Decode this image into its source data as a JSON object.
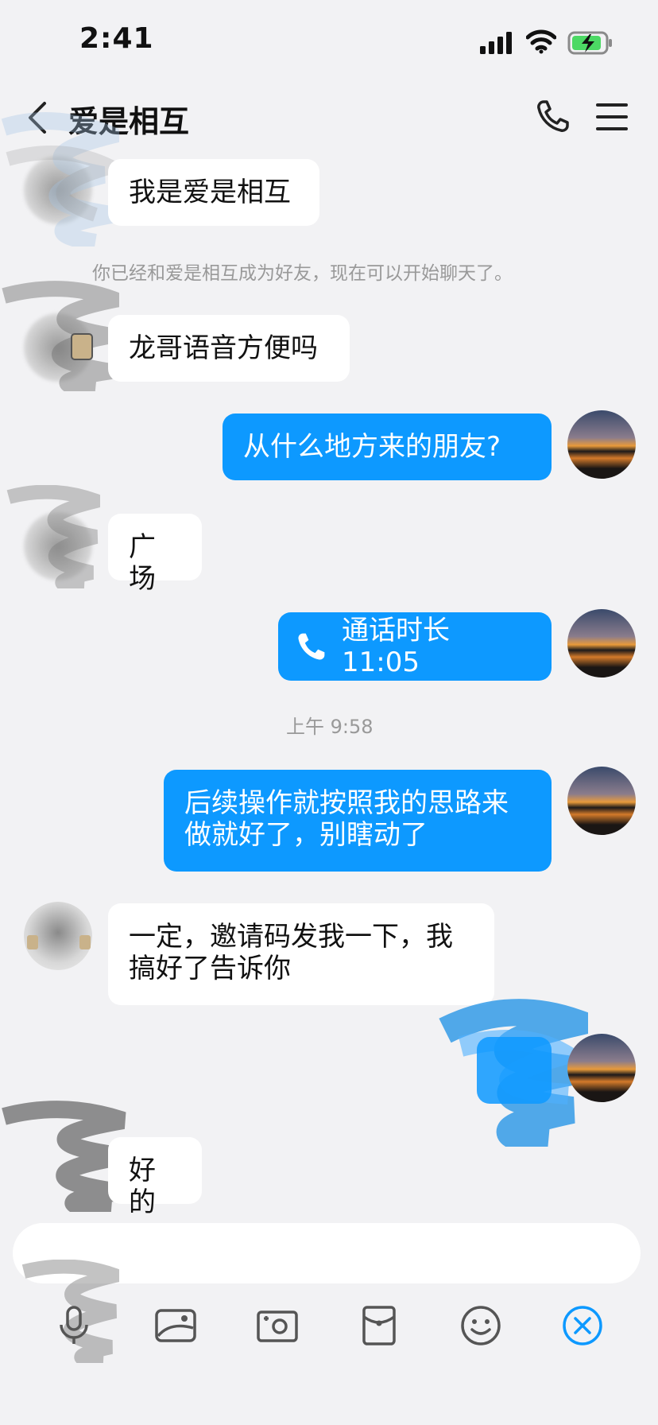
{
  "status_bar": {
    "time": "2:41"
  },
  "header": {
    "title": "爱是相互"
  },
  "messages": {
    "m1": "我是爱是相互",
    "system": "你已经和爱是相互成为好友，现在可以开始聊天了。",
    "m2": "龙哥语音方便吗",
    "m3": "从什么地方来的朋友?",
    "m4": "广场",
    "m5_call": "通话时长 11:05",
    "timestamp": "上午 9:58",
    "m6_line1": "后续操作就按照我的思路来",
    "m6_line2": "做就好了，别瞎动了",
    "m7_line1": "一定，邀请码发我一下，我",
    "m7_line2": "搞好了告诉你",
    "m9": "好的"
  },
  "colors": {
    "accent": "#0d99ff",
    "background": "#f2f2f4",
    "bubble_left": "#ffffff"
  },
  "toolbar_icons": [
    "microphone-icon",
    "image-icon",
    "camera-icon",
    "red-packet-icon",
    "emoji-icon",
    "close-icon"
  ]
}
